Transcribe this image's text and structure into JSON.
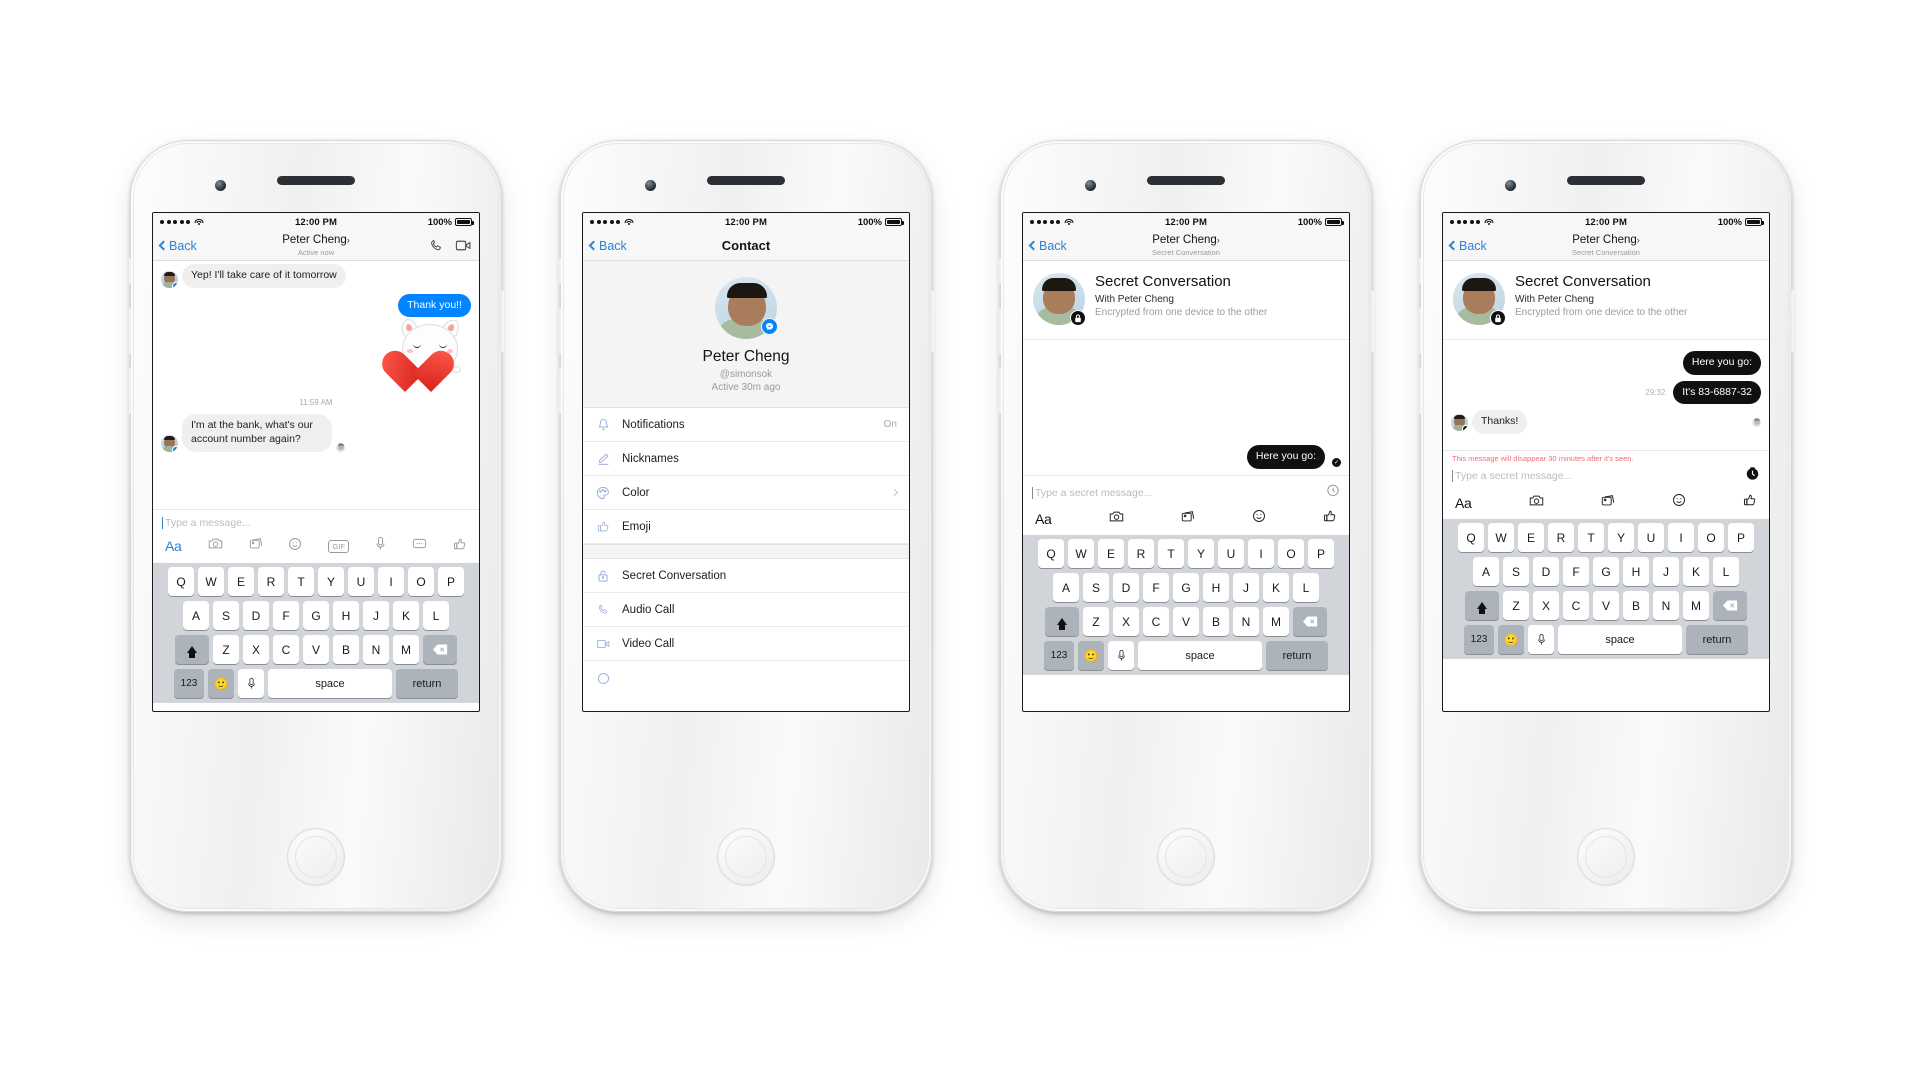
{
  "status_bar": {
    "time": "12:00 PM",
    "battery": "100%",
    "signal_dots": 5
  },
  "phone1": {
    "nav": {
      "back": "Back",
      "title": "Peter Cheng",
      "chevron": "›",
      "subtitle": "Active now",
      "audio_icon": "phone-icon",
      "video_icon": "video-camera-icon"
    },
    "messages": [
      {
        "side": "them",
        "text": "Yep! I'll take care of it tomorrow"
      },
      {
        "side": "me",
        "text": "Thank you!!"
      },
      {
        "side": "sticker",
        "text": "cat-hugging-heart-sticker"
      },
      {
        "side": "timestamp",
        "text": "11:59 AM"
      },
      {
        "side": "them",
        "text": "I'm at the bank, what's our account number again?"
      }
    ],
    "composer": {
      "placeholder": "Type a message...",
      "tools": [
        "Aa",
        "camera-icon",
        "photos-icon",
        "sticker-smiley-icon",
        "GIF",
        "microphone-icon",
        "more-dots-icon",
        "thumbs-up-icon"
      ]
    }
  },
  "phone2": {
    "nav": {
      "back": "Back",
      "title": "Contact"
    },
    "profile": {
      "name": "Peter Cheng",
      "username": "@simonsok",
      "active": "Active 30m ago",
      "badge_icon": "messenger-badge-icon"
    },
    "menu_group_1": [
      {
        "label": "Notifications",
        "icon": "bell-icon",
        "value": "On"
      },
      {
        "label": "Nicknames",
        "icon": "pencil-icon",
        "value": ""
      },
      {
        "label": "Color",
        "icon": "palette-icon",
        "value": "chevron"
      },
      {
        "label": "Emoji",
        "icon": "thumbs-up-icon",
        "value": ""
      }
    ],
    "menu_group_2": [
      {
        "label": "Secret Conversation",
        "icon": "lock-icon",
        "value": ""
      },
      {
        "label": "Audio Call",
        "icon": "phone-icon",
        "value": ""
      },
      {
        "label": "Video Call",
        "icon": "video-camera-icon",
        "value": ""
      }
    ]
  },
  "phone3": {
    "nav": {
      "back": "Back",
      "title": "Peter Cheng",
      "chevron": "›",
      "subtitle": "Secret Conversation"
    },
    "header": {
      "title": "Secret Conversation",
      "with": "With Peter Cheng",
      "desc": "Encrypted from one device to the other",
      "lock_icon": "lock-icon"
    },
    "messages": [
      {
        "side": "me-secret",
        "text": "Here you go:",
        "seen": true
      }
    ],
    "composer": {
      "placeholder": "Type a secret message...",
      "timer_icon": "timer-icon",
      "tools": [
        "Aa",
        "camera-icon",
        "photos-icon",
        "sticker-smiley-icon",
        "thumbs-up-icon"
      ]
    }
  },
  "phone4": {
    "nav": {
      "back": "Back",
      "title": "Peter Cheng",
      "chevron": "›",
      "subtitle": "Secret Conversation"
    },
    "header": {
      "title": "Secret Conversation",
      "with": "With Peter Cheng",
      "desc": "Encrypted from one device to the other",
      "lock_icon": "lock-icon"
    },
    "messages": [
      {
        "side": "me-secret",
        "text": "Here you go:"
      },
      {
        "side": "me-secret",
        "text": "It's 83-6887-32",
        "timer": "29:32"
      },
      {
        "side": "them",
        "text": "Thanks!"
      }
    ],
    "warning": "This message will disappear 30 minutes after it's seen.",
    "composer": {
      "placeholder": "Type a secret message...",
      "timer_icon": "timer-icon-active",
      "tools": [
        "Aa",
        "camera-icon",
        "photos-icon",
        "sticker-smiley-icon",
        "thumbs-up-icon"
      ]
    }
  },
  "keyboard": {
    "row1": [
      "Q",
      "W",
      "E",
      "R",
      "T",
      "Y",
      "U",
      "I",
      "O",
      "P"
    ],
    "row2": [
      "A",
      "S",
      "D",
      "F",
      "G",
      "H",
      "J",
      "K",
      "L"
    ],
    "row3": [
      "Z",
      "X",
      "C",
      "V",
      "B",
      "N",
      "M"
    ],
    "shift_icon": "shift-up-arrow-icon",
    "backspace_icon": "backspace-icon",
    "numbers_key": "123",
    "emoji_key": "smiley-face-icon",
    "mic_key": "microphone-icon",
    "space_key": "space",
    "return_key": "return"
  },
  "colors": {
    "messenger_blue": "#0084ff",
    "ios_blue": "#2d83d8",
    "secret_black": "#101010",
    "warning_red": "#e8707a",
    "bubble_gray": "#efefef"
  }
}
